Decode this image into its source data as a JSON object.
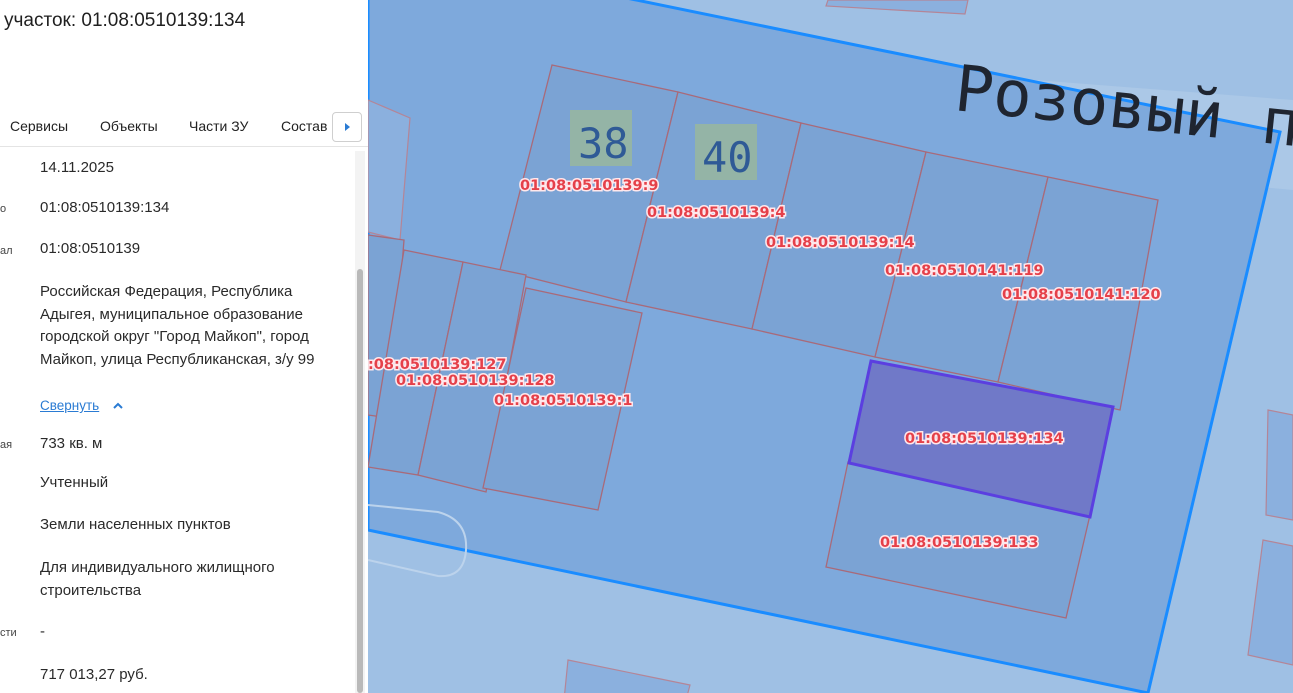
{
  "panel": {
    "title": "участок: 01:08:0510139:134",
    "tabs": [
      "Сервисы",
      "Объекты",
      "Части ЗУ",
      "Состав"
    ],
    "rows": {
      "date": {
        "label": "",
        "value": "14.11.2025"
      },
      "cad_number": {
        "label": "о",
        "value": "01:08:0510139:134"
      },
      "quarter": {
        "label": "ал",
        "value": "01:08:0510139"
      },
      "address": {
        "label": "",
        "value": "Российская Федерация, Республика Адыгея, муниципальное образование городской округ \"Город Майкоп\", город Майкоп, улица Республиканская, з/у 99"
      },
      "area": {
        "label": "ая",
        "value": "733 кв. м"
      },
      "status": {
        "label": "",
        "value": "Учтенный"
      },
      "category": {
        "label": "",
        "value": "Земли населенных пунктов"
      },
      "permitted_use": {
        "label": "",
        "value": "Для индивидуального жилищного строительства"
      },
      "misc": {
        "label": "сти",
        "value": "-"
      },
      "cad_value": {
        "label": "",
        "value": "717 013,27 руб."
      }
    },
    "collapse_link": "Свернуть"
  },
  "map": {
    "street_label": "Розовый п",
    "house_numbers": [
      "38",
      "40"
    ],
    "parcel_labels": [
      "01:08:0510139:9",
      "01:08:0510139:4",
      "01:08:0510139:14",
      "01:08:0510141:119",
      "01:08:0510141:120",
      ":08:0510139:127",
      "01:08:0510139:128",
      "01:08:0510139:1",
      "01:08:0510139:134",
      "01:08:0510139:133"
    ],
    "selected_parcel": "01:08:0510139:134",
    "colors": {
      "map_background": "#9fc0e4",
      "quarter_fill": "#7ea9dc",
      "quarter_border": "#1a8cff",
      "parcel_border": "#a86a7a",
      "selected_fill": "#7079c8",
      "selected_border": "#5b3fe0",
      "label_text": "#e5404a",
      "link": "#2a7bd3"
    }
  }
}
